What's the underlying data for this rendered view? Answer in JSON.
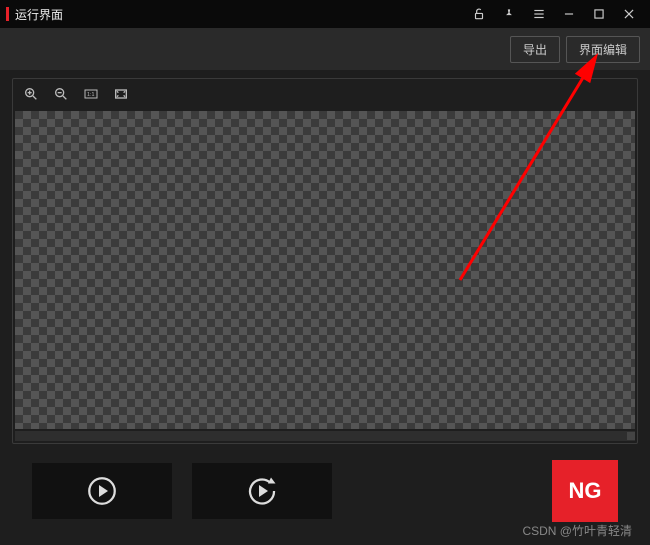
{
  "window": {
    "title": "运行界面"
  },
  "topbar": {
    "export_label": "导出",
    "edit_ui_label": "界面编辑"
  },
  "status": {
    "ng_label": "NG"
  },
  "watermark": {
    "text": "CSDN @竹叶青轻清"
  }
}
